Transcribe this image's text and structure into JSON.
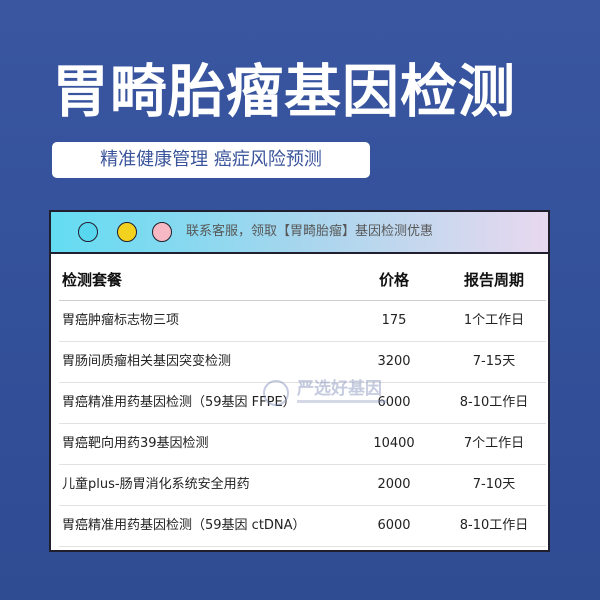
{
  "headline": "胃畸胎瘤基因检测",
  "subtitle": "精准健康管理 癌症风险预测",
  "card": {
    "bar_text": "联系客服，领取【胃畸胎瘤】基因检测优惠",
    "watermark": "严选好基因",
    "colors": {
      "dot_cyan": "#59d7ef",
      "dot_yellow": "#f3d21f",
      "dot_pink": "#f6b9c4"
    }
  },
  "table": {
    "headers": {
      "name": "检测套餐",
      "price": "价格",
      "period": "报告周期"
    },
    "rows": [
      {
        "name": "胃癌肿瘤标志物三项",
        "price": "175",
        "period": "1个工作日"
      },
      {
        "name": "胃肠间质瘤相关基因突变检测",
        "price": "3200",
        "period": "7-15天"
      },
      {
        "name": "胃癌精准用药基因检测（59基因 FFPE）",
        "price": "6000",
        "period": "8-10工作日"
      },
      {
        "name": "胃癌靶向用药39基因检测",
        "price": "10400",
        "period": "7个工作日"
      },
      {
        "name": "儿童plus-肠胃消化系统安全用药",
        "price": "2000",
        "period": "7-10天"
      },
      {
        "name": "胃癌精准用药基因检测（59基因 ctDNA）",
        "price": "6000",
        "period": "8-10工作日"
      }
    ]
  }
}
